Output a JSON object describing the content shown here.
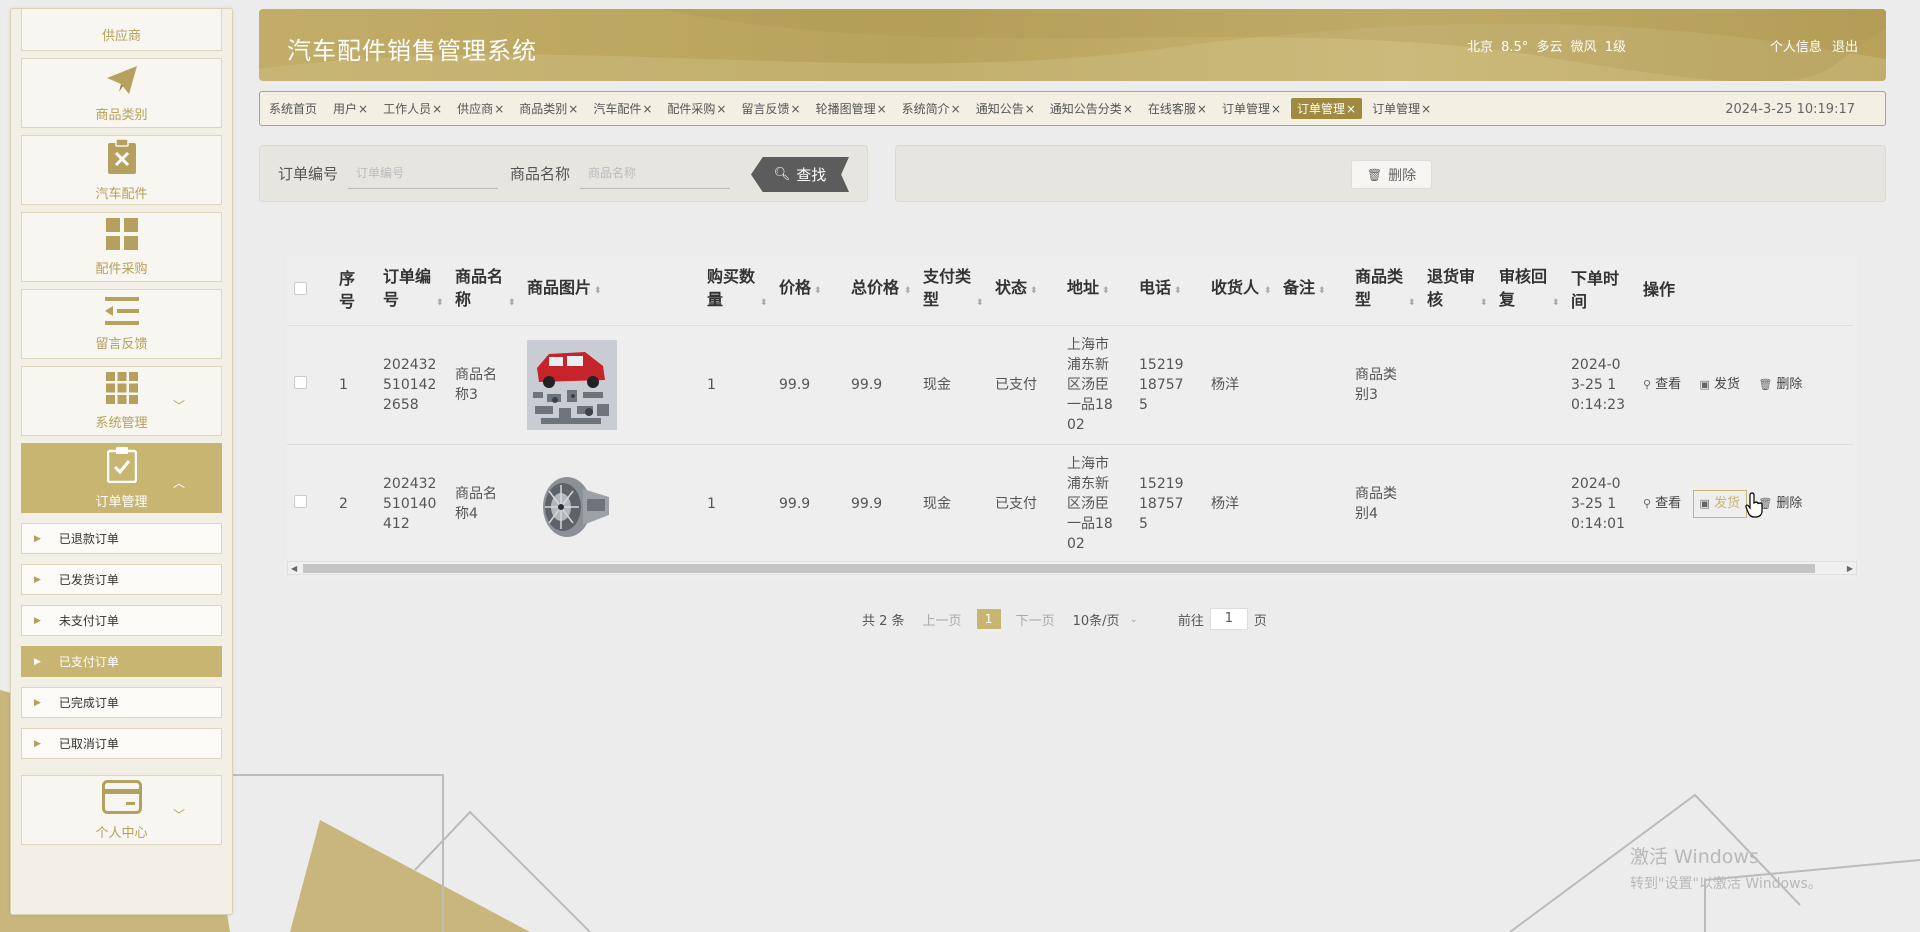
{
  "colors": {
    "accent": "#c8b572",
    "header": "#b9a45e",
    "dark_button": "#5c5c5c"
  },
  "sidebar": {
    "items": [
      {
        "label": "供应商",
        "icon": "supplier-icon"
      },
      {
        "label": "商品类别",
        "icon": "paper-plane-icon"
      },
      {
        "label": "汽车配件",
        "icon": "clipboard-x-icon"
      },
      {
        "label": "配件采购",
        "icon": "grid-four-icon"
      },
      {
        "label": "留言反馈",
        "icon": "list-arrow-icon"
      },
      {
        "label": "系统管理",
        "icon": "grid-nine-icon",
        "chevron": "﹀"
      },
      {
        "label": "订单管理",
        "icon": "clipboard-check-icon",
        "chevron": "︿"
      }
    ],
    "sub_items": [
      "已退款订单",
      "已发货订单",
      "未支付订单",
      "已支付订单",
      "已完成订单",
      "已取消订单"
    ],
    "personal": {
      "label": "个人中心",
      "icon": "card-icon",
      "chevron": "﹀"
    }
  },
  "header": {
    "title": "汽车配件销售管理系统",
    "weather": "北京 8.5° 多云 微风 1级",
    "profile": "个人信息",
    "logout": "退出"
  },
  "tabs": [
    {
      "label": "系统首页",
      "close": ""
    },
    {
      "label": "用户",
      "close": "×"
    },
    {
      "label": "工作人员",
      "close": "×"
    },
    {
      "label": "供应商",
      "close": "×"
    },
    {
      "label": "商品类别",
      "close": "×"
    },
    {
      "label": "汽车配件",
      "close": "×"
    },
    {
      "label": "配件采购",
      "close": "×"
    },
    {
      "label": "留言反馈",
      "close": "×"
    },
    {
      "label": "轮播图管理",
      "close": "×"
    },
    {
      "label": "系统简介",
      "close": "×"
    },
    {
      "label": "通知公告",
      "close": "×"
    },
    {
      "label": "通知公告分类",
      "close": "×"
    },
    {
      "label": "在线客服",
      "close": "×"
    },
    {
      "label": "订单管理",
      "close": "×"
    },
    {
      "label": "订单管理",
      "close": "×"
    },
    {
      "label": "订单管理",
      "close": "×"
    }
  ],
  "clock": "2024-3-25 10:19:17",
  "search": {
    "order_no_label": "订单编号",
    "order_no_placeholder": "订单编号",
    "product_label": "商品名称",
    "product_placeholder": "商品名称",
    "button": "查找"
  },
  "actions": {
    "delete": "删除"
  },
  "table": {
    "headers": [
      "序号",
      "订单编号",
      "商品名称",
      "商品图片",
      "购买数量",
      "价格",
      "总价格",
      "支付类型",
      "状态",
      "地址",
      "电话",
      "收货人",
      "备注",
      "商品类型",
      "退货审核",
      "审核回复",
      "下单时间",
      "操作"
    ],
    "ops": {
      "view": "查看",
      "ship": "发货",
      "delete": "删除"
    },
    "rows": [
      {
        "idx": "1",
        "order_no": "2024325101422658",
        "product": "商品名称3",
        "qty": "1",
        "price": "99.9",
        "total": "99.9",
        "pay": "现金",
        "status": "已支付",
        "address": "上海市浦东新区汤臣一品1802",
        "phone": "15219187575",
        "receiver": "杨洋",
        "note": "",
        "ptype": "商品类别3",
        "return_review": "",
        "review_reply": "",
        "time": "2024-03-25 10:14:23"
      },
      {
        "idx": "2",
        "order_no": "202432510140412",
        "product": "商品名称4",
        "qty": "1",
        "price": "99.9",
        "total": "99.9",
        "pay": "现金",
        "status": "已支付",
        "address": "上海市浦东新区汤臣一品1802",
        "phone": "15219187575",
        "receiver": "杨洋",
        "note": "",
        "ptype": "商品类别4",
        "return_review": "",
        "review_reply": "",
        "time": "2024-03-25 10:14:01"
      }
    ]
  },
  "pager": {
    "total": "共 2 条",
    "prev": "上一页",
    "current": "1",
    "next": "下一页",
    "size": "10条/页",
    "goto_label": "前往",
    "goto_value": "1",
    "page_unit": "页"
  },
  "watermark": {
    "line1": "激活 Windows",
    "line2": "转到\"设置\"以激活 Windows。"
  }
}
